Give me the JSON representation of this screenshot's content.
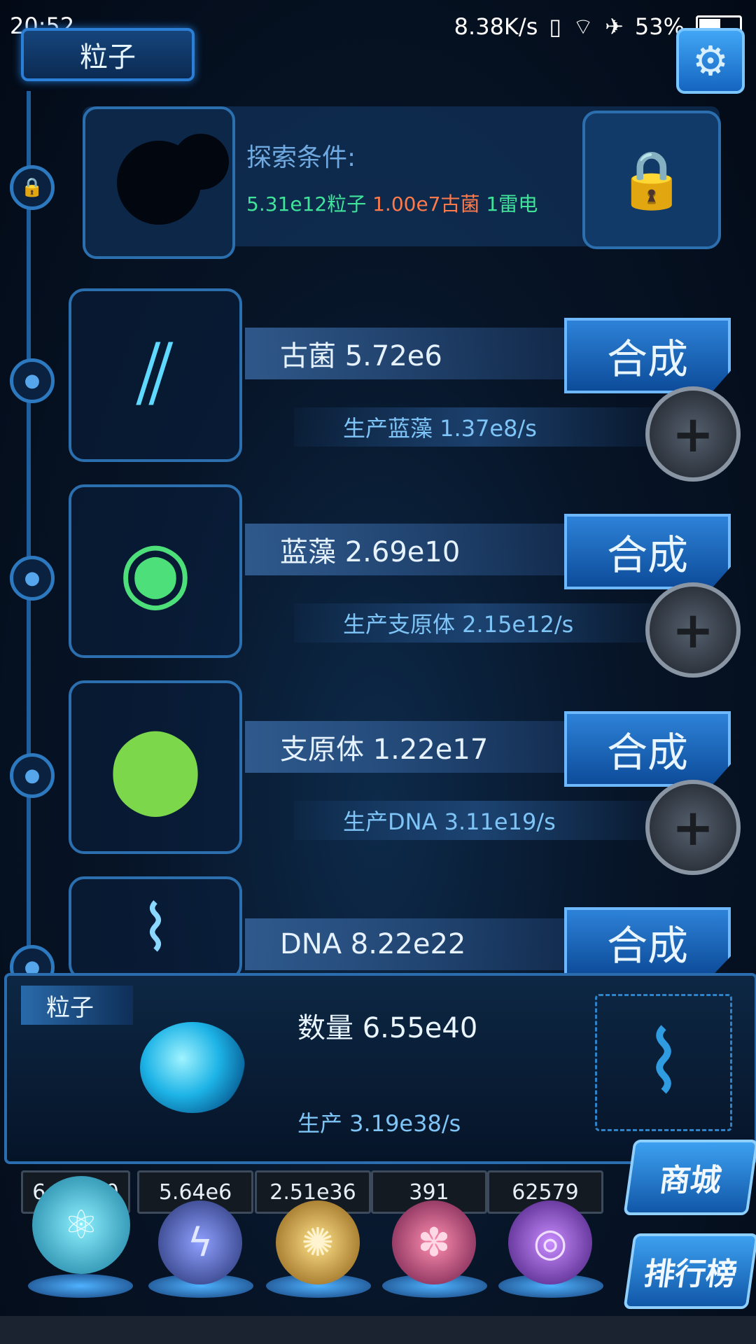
{
  "status_bar": {
    "time": "20:52",
    "speed": "8.38K/s",
    "battery": "53%"
  },
  "header": {
    "title": "粒子"
  },
  "explore": {
    "title": "探索条件:",
    "cond1": "5.31e12粒子",
    "cond2": "1.00e7古菌",
    "cond3": "1雷电"
  },
  "items": [
    {
      "name": "古菌 5.72e6",
      "production": "生产蓝藻 1.37e8/s",
      "synth": "合成"
    },
    {
      "name": "蓝藻 2.69e10",
      "production": "生产支原体 2.15e12/s",
      "synth": "合成"
    },
    {
      "name": "支原体 1.22e17",
      "production": "生产DNA 3.11e19/s",
      "synth": "合成"
    },
    {
      "name": "DNA 8.22e22",
      "production": "",
      "synth": "合成"
    }
  ],
  "panel": {
    "tag": "粒子",
    "count": "数量 6.55e40",
    "production": "生产 3.19e38/s"
  },
  "resources": [
    "6.55e40",
    "5.64e6",
    "2.51e36",
    "391",
    "62579"
  ],
  "side_buttons": {
    "shop": "商城",
    "rank": "排行榜"
  },
  "icons": {
    "gear": "gear-icon",
    "lock": "lock-icon",
    "plus": "plus-icon"
  },
  "colors": {
    "green": "#3fe49a",
    "orange": "#ff7a4a",
    "accent": "#2d82d8"
  }
}
